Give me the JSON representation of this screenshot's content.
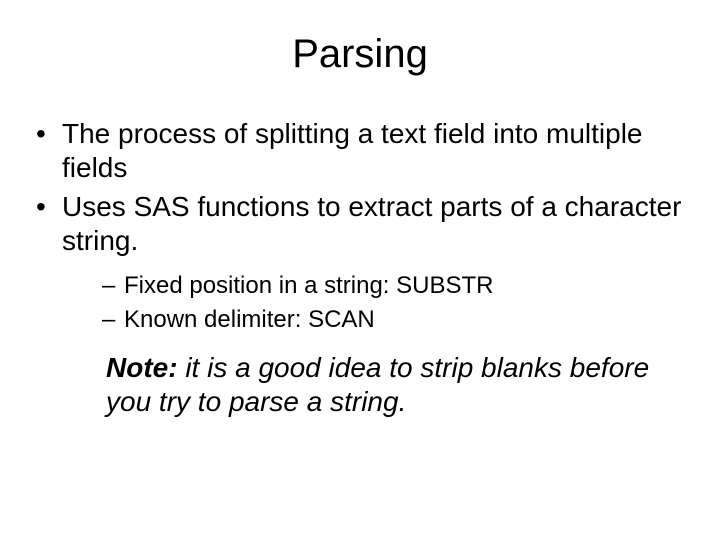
{
  "title": "Parsing",
  "bullets": {
    "b1": "The process of splitting a text field into multiple fields",
    "b2": "Uses SAS functions to extract parts of a character string."
  },
  "subbullets": {
    "s1": "Fixed position in a string:  SUBSTR",
    "s2": "Known delimiter:  SCAN"
  },
  "note": {
    "label": "Note:",
    "text": " it is a good idea to strip blanks before you try to parse a string."
  }
}
